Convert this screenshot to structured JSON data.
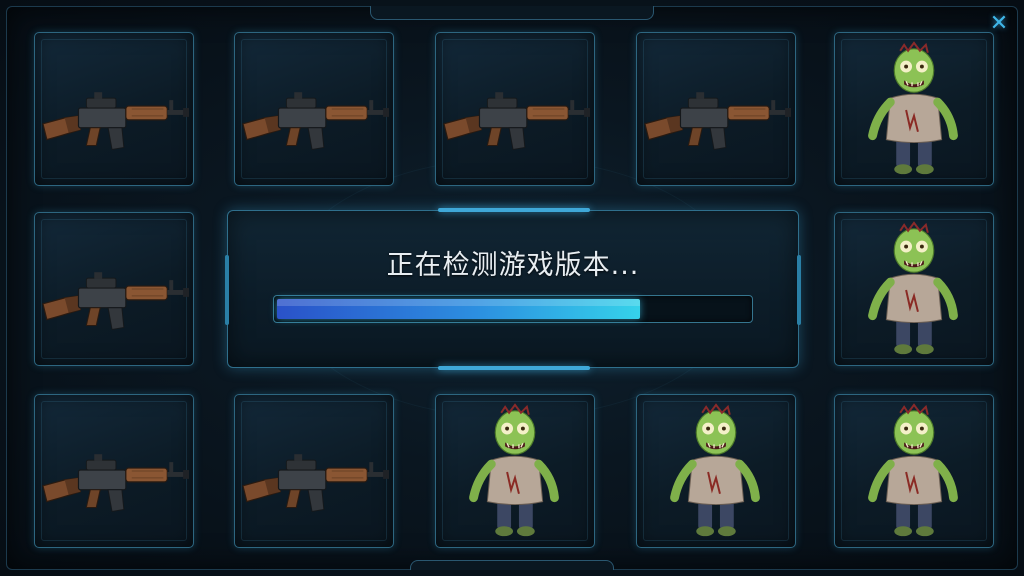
{
  "loading": {
    "status_text": "正在检测游戏版本...",
    "progress": 0.77
  },
  "tiles": [
    {
      "row": 1,
      "col": 1,
      "icon": "rifle-icon"
    },
    {
      "row": 1,
      "col": 2,
      "icon": "rifle-icon"
    },
    {
      "row": 1,
      "col": 3,
      "icon": "rifle-icon"
    },
    {
      "row": 1,
      "col": 4,
      "icon": "rifle-icon"
    },
    {
      "row": 1,
      "col": 5,
      "icon": "zombie-icon"
    },
    {
      "row": 2,
      "col": 1,
      "icon": "rifle-icon"
    },
    {
      "row": 2,
      "col": 5,
      "icon": "zombie-icon"
    },
    {
      "row": 3,
      "col": 1,
      "icon": "rifle-icon"
    },
    {
      "row": 3,
      "col": 2,
      "icon": "rifle-icon"
    },
    {
      "row": 3,
      "col": 3,
      "icon": "zombie-icon"
    },
    {
      "row": 3,
      "col": 4,
      "icon": "zombie-icon"
    },
    {
      "row": 3,
      "col": 5,
      "icon": "zombie-icon"
    }
  ],
  "close_icon": "close-icon",
  "colors": {
    "accent": "#3fa8d8",
    "progress_start": "#2a52c9",
    "progress_end": "#35d2ea",
    "tile_border": "#2d6680"
  }
}
